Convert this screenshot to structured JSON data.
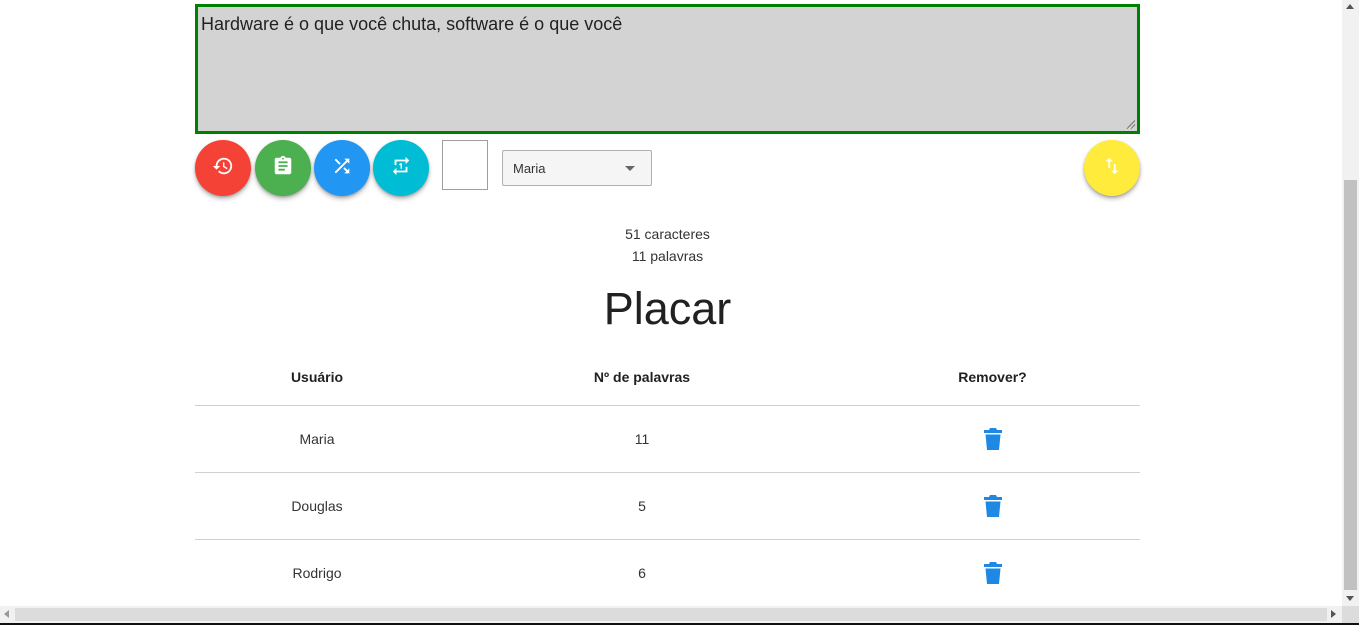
{
  "editor": {
    "text": "Hardware é o que você chuta, software é o que você",
    "border_color": "#008000",
    "background": "#d3d3d3"
  },
  "toolbar": {
    "buttons": [
      {
        "name": "restart",
        "icon": "restore-icon",
        "color": "#f44336"
      },
      {
        "name": "paste",
        "icon": "clipboard-icon",
        "color": "#4caf50"
      },
      {
        "name": "shuffle",
        "icon": "shuffle-icon",
        "color": "#2196f3"
      },
      {
        "name": "repeat-once",
        "icon": "repeat-one-icon",
        "color": "#00bcd4"
      },
      {
        "name": "sort",
        "icon": "swap-vertical-icon",
        "color": "#ffeb3b"
      }
    ],
    "user_select": {
      "selected": "Maria"
    }
  },
  "stats": {
    "characters": "51 caracteres",
    "words": "11 palavras"
  },
  "scoreboard": {
    "title": "Placar",
    "headers": [
      "Usuário",
      "Nº de palavras",
      "Remover?"
    ],
    "rows": [
      {
        "user": "Maria",
        "words": "11"
      },
      {
        "user": "Douglas",
        "words": "5"
      },
      {
        "user": "Rodrigo",
        "words": "6"
      }
    ],
    "delete_icon": "trash-icon",
    "delete_color": "#1e88e5"
  }
}
